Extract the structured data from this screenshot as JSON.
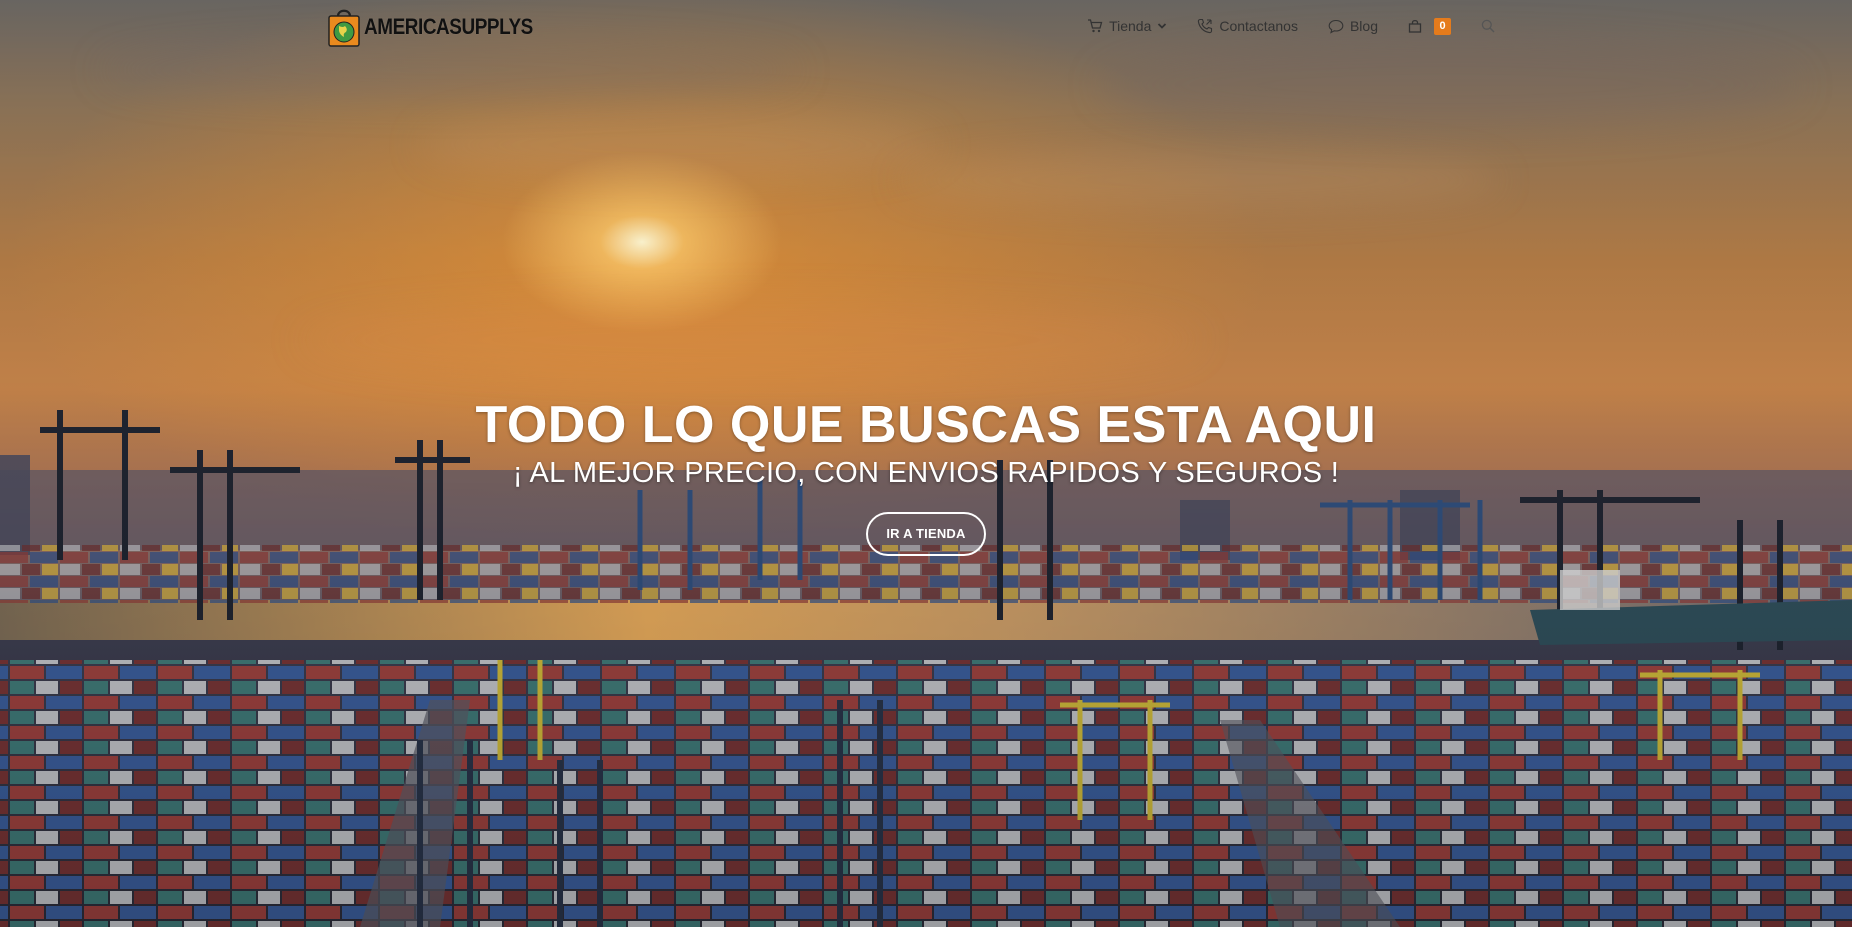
{
  "brand": {
    "name": "AMERICASUPPLYS",
    "logo_icon": "shopping-bag-globe-icon",
    "accent_color": "#e57b1c"
  },
  "nav": {
    "items": [
      {
        "label": "Tienda",
        "icon": "cart-icon",
        "has_dropdown": true
      },
      {
        "label": "Contactanos",
        "icon": "phone-icon"
      },
      {
        "label": "Blog",
        "icon": "chat-bubble-icon"
      }
    ],
    "cart": {
      "icon": "shopping-bag-icon",
      "count": "0"
    },
    "search_icon": "search-icon"
  },
  "hero": {
    "title": "TODO LO QUE BUSCAS ESTA AQUI",
    "subtitle": "¡ AL MEJOR PRECIO, CON ENVIOS RAPIDOS Y SEGUROS !",
    "button_label": "IR A TIENDA",
    "background": "sunset-port-container-terminal-photo"
  }
}
